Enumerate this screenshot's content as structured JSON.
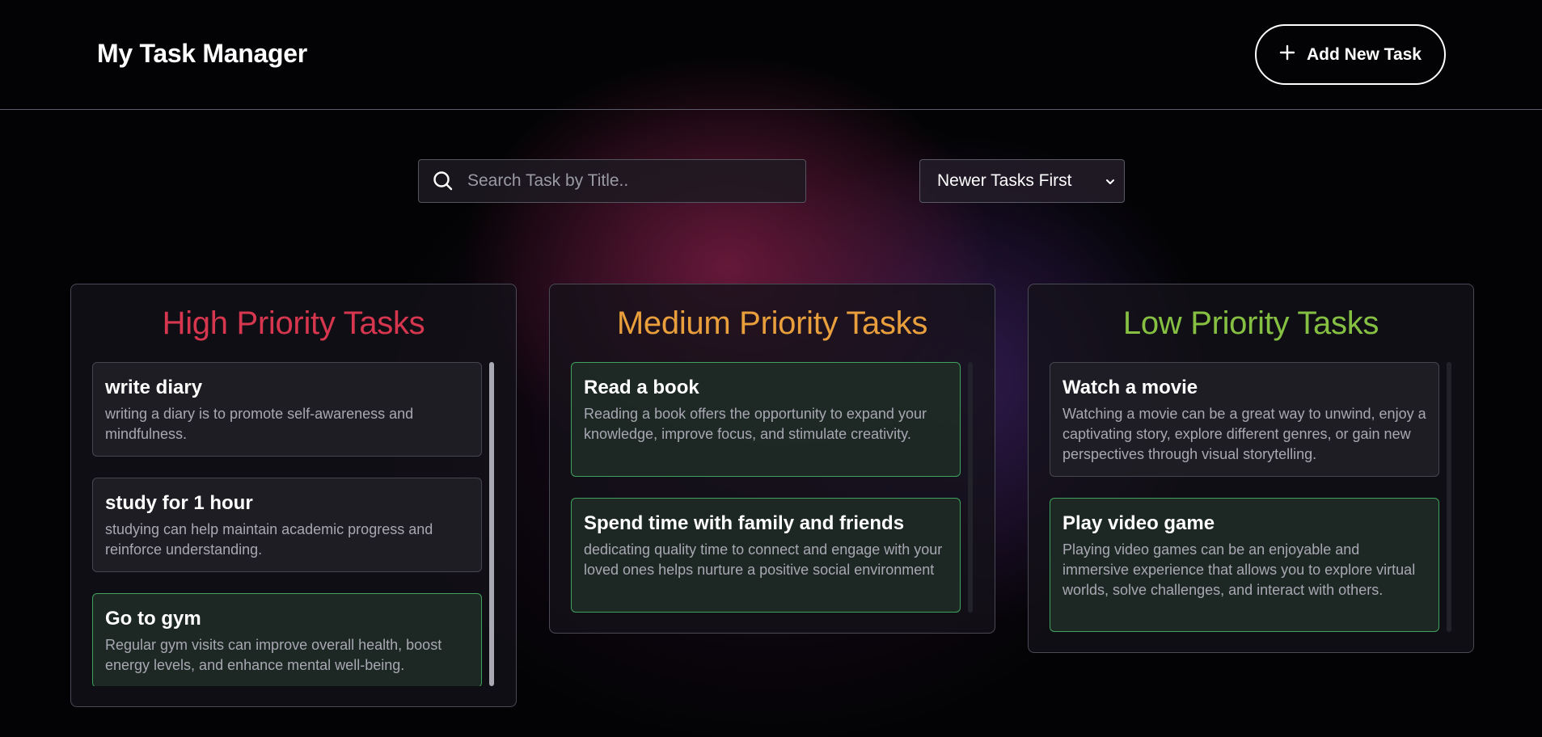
{
  "header": {
    "title": "My Task Manager",
    "add_button_label": "Add New Task",
    "add_button_icon": "plus-icon"
  },
  "search": {
    "placeholder": "Search Task by Title..",
    "value": "",
    "icon": "search-icon"
  },
  "sort": {
    "selected": "Newer Tasks First",
    "icon": "chevron-down-icon"
  },
  "colors": {
    "high": "#d6364e",
    "medium": "#e99f3b",
    "low": "#86c042",
    "completed_border": "#3ea35c"
  },
  "columns": [
    {
      "title": "High Priority Tasks",
      "color": "#d6364e",
      "tasks": [
        {
          "title": "write diary",
          "description": "writing a diary is to promote self-awareness and mindfulness.",
          "completed": false
        },
        {
          "title": "study for 1 hour",
          "description": "studying can help maintain academic progress and reinforce understanding.",
          "completed": false
        },
        {
          "title": "Go to gym",
          "description": "Regular gym visits can improve overall health, boost energy levels, and enhance mental well-being.",
          "completed": true
        }
      ]
    },
    {
      "title": "Medium Priority Tasks",
      "color": "#e99f3b",
      "tasks": [
        {
          "title": "Read a book",
          "description": "Reading a book offers the opportunity to expand your knowledge, improve focus, and stimulate creativity.",
          "completed": true
        },
        {
          "title": "Spend time with family and friends",
          "description": "dedicating quality time to connect and engage with your loved ones helps nurture a positive social environment",
          "completed": true
        }
      ]
    },
    {
      "title": "Low Priority Tasks",
      "color": "#86c042",
      "tasks": [
        {
          "title": "Watch a movie",
          "description": "Watching a movie can be a great way to unwind, enjoy a captivating story, explore different genres, or gain new perspectives through visual storytelling.",
          "completed": false
        },
        {
          "title": "Play video game",
          "description": "Playing video games can be an enjoyable and immersive experience that allows you to explore virtual worlds, solve challenges, and interact with others.",
          "completed": true
        }
      ]
    }
  ]
}
